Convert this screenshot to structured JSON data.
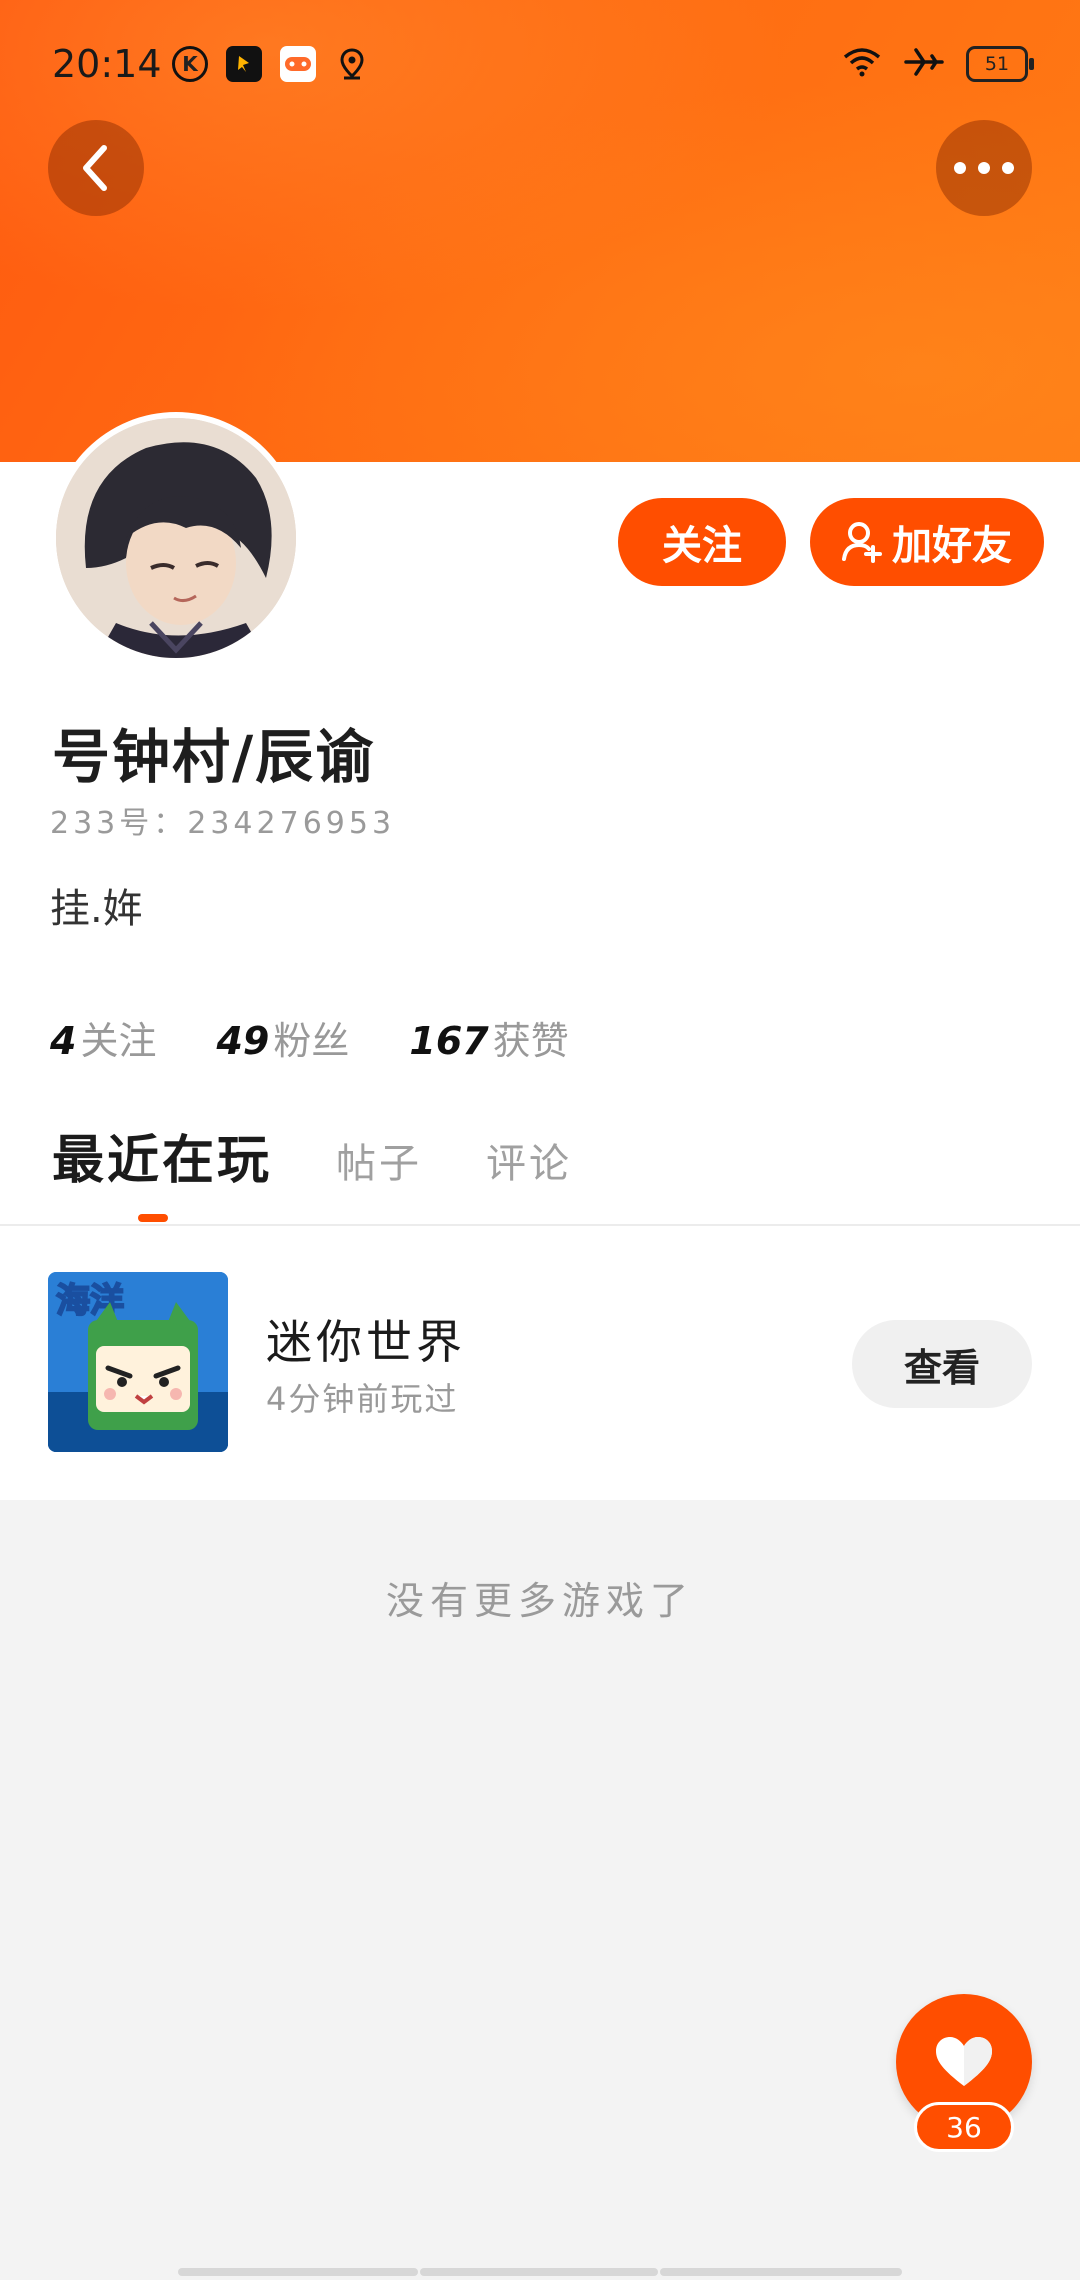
{
  "status_bar": {
    "time": "20:14",
    "battery": "51",
    "left_icons": [
      "k-app-icon",
      "pin-app-icon",
      "game-app-icon",
      "location-icon"
    ],
    "right_icons": [
      "wifi-icon",
      "airplane-icon",
      "battery-icon"
    ]
  },
  "header": {
    "back_icon": "chevron-left-icon",
    "more_icon": "more-dots-icon",
    "accent_color": "#ff4e00"
  },
  "profile": {
    "nickname": "号钟村/辰谕",
    "uid": "233号：234276953",
    "bio": "挂.姩",
    "follow_label": "关注",
    "add_friend_label": "加好友",
    "stats": [
      {
        "num": "4",
        "label": "关注"
      },
      {
        "num": "49",
        "label": "粉丝"
      },
      {
        "num": "167",
        "label": "获赞"
      }
    ]
  },
  "tabs": [
    {
      "label": "最近在玩",
      "active": true
    },
    {
      "label": "帖子",
      "active": false
    },
    {
      "label": "评论",
      "active": false
    }
  ],
  "games": [
    {
      "title": "迷你世界",
      "subtitle": "4分钟前玩过",
      "action": "查看",
      "thumb_label": "海洋"
    }
  ],
  "footer": {
    "no_more": "没有更多游戏了"
  },
  "like": {
    "count": "36",
    "icon": "heart-icon"
  }
}
